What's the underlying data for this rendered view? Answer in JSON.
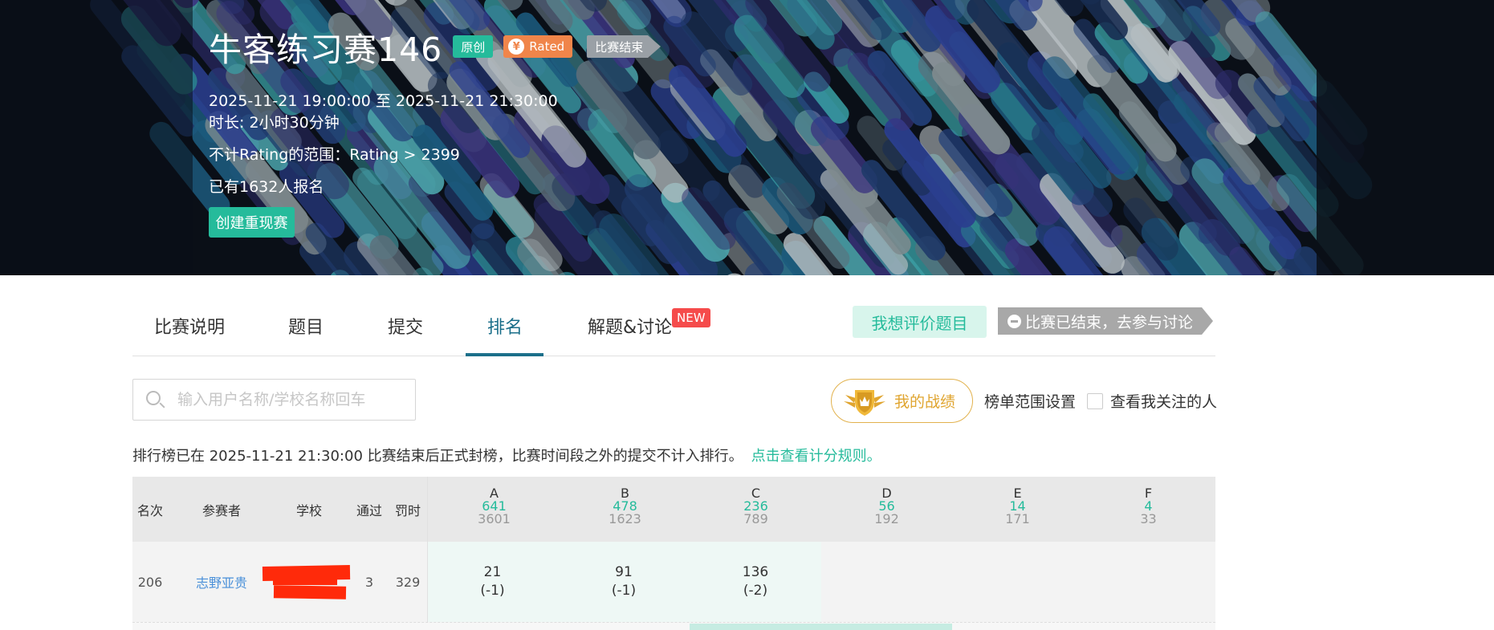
{
  "banner": {
    "title": "牛客练习赛146",
    "tags": {
      "original": "原创",
      "rated": "Rated",
      "rated_icon": "yen-icon",
      "ended": "比赛结束"
    },
    "time_range": "2025-11-21 19:00:00 至 2025-11-21 21:30:00",
    "duration": "时长: 2小时30分钟",
    "rating_range": "不计Rating的范围：Rating > 2399",
    "registered": "已有1632人报名",
    "replay_button": "创建重现赛"
  },
  "nav": {
    "tabs": [
      {
        "label": "比赛说明",
        "active": false
      },
      {
        "label": "题目",
        "active": false
      },
      {
        "label": "提交",
        "active": false
      },
      {
        "label": "排名",
        "active": true
      },
      {
        "label": "解题&讨论",
        "active": false
      }
    ],
    "new_badge": "NEW",
    "evaluate_button": "我想评价题目",
    "discuss_button": "比赛已结束，去参与讨论"
  },
  "toolbar": {
    "search_placeholder": "输入用户名称/学校名称回车",
    "my_record": "我的战绩",
    "range_settings": "榜单范围设置",
    "follow_label": "查看我关注的人",
    "follow_checked": false
  },
  "notice": {
    "text": "排行榜已在 2025-11-21 21:30:00 比赛结束后正式封榜，比赛时间段之外的提交不计入排行。",
    "link": "点击查看计分规则。"
  },
  "table": {
    "headers": {
      "rank": "名次",
      "participant": "参赛者",
      "school": "学校",
      "solved": "通过",
      "penalty": "罚时"
    },
    "problems": [
      {
        "letter": "A",
        "accepted": "641",
        "attempted": "3601"
      },
      {
        "letter": "B",
        "accepted": "478",
        "attempted": "1623"
      },
      {
        "letter": "C",
        "accepted": "236",
        "attempted": "789"
      },
      {
        "letter": "D",
        "accepted": "56",
        "attempted": "192"
      },
      {
        "letter": "E",
        "accepted": "14",
        "attempted": "171"
      },
      {
        "letter": "F",
        "accepted": "4",
        "attempted": "33"
      }
    ],
    "rows": [
      {
        "rank": "206",
        "name": "志野亚贵",
        "school": "",
        "solved": "3",
        "penalty": "329",
        "results": [
          {
            "time": "21",
            "wrong": "(-1)"
          },
          {
            "time": "91",
            "wrong": "(-1)"
          },
          {
            "time": "136",
            "wrong": "(-2)"
          },
          {
            "time": "",
            "wrong": ""
          },
          {
            "time": "",
            "wrong": ""
          },
          {
            "time": "",
            "wrong": ""
          }
        ]
      }
    ]
  },
  "colors": {
    "accent": "#25bb9b",
    "rated": "#f0854a",
    "new_badge": "#f54b4b",
    "active_tab": "#1b6f8a",
    "gold": "#e0a530",
    "redaction": "#ff2a0a"
  }
}
